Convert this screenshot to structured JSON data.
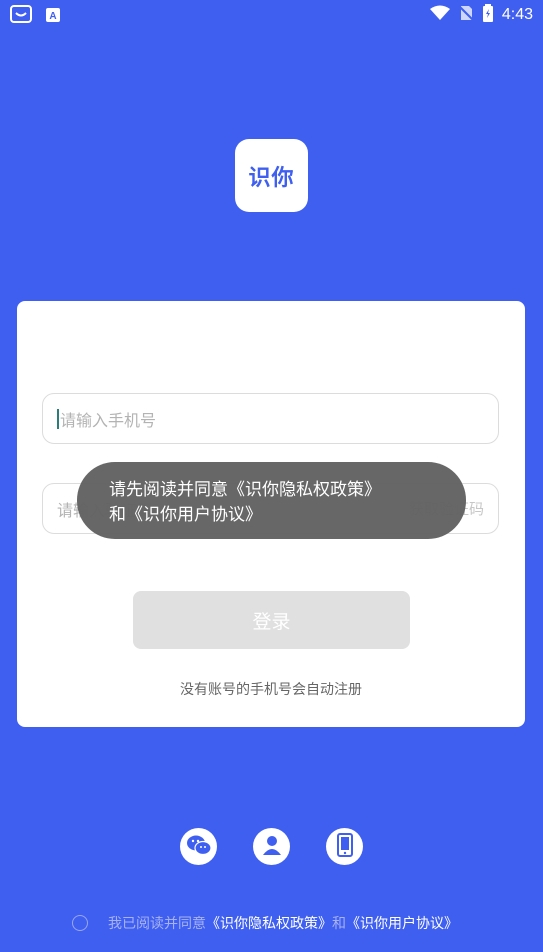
{
  "status_bar": {
    "time": "4:43",
    "left_icons": [
      "face-frame-icon",
      "a-app-icon"
    ],
    "right_icons": [
      "wifi-icon",
      "no-sim-icon",
      "battery-icon"
    ]
  },
  "logo": {
    "text": "识你"
  },
  "form": {
    "phone_placeholder": "请输入手机号",
    "code_placeholder": "请输入验证码",
    "get_code_label": "获取验证码",
    "login_label": "登录",
    "hint": "没有账号的手机号会自动注册"
  },
  "toast": {
    "line1": "请先阅读并同意《识你隐私权政策》",
    "line2": "和《识你用户协议》"
  },
  "social_logins": [
    "wechat-icon",
    "user-icon",
    "phone-icon"
  ],
  "agreement": {
    "prefix": "我已阅读并同意",
    "privacy": "《识你隐私权政策》",
    "and": "和",
    "terms": "《识你用户协议》"
  },
  "colors": {
    "brand": "#3f5ff0",
    "toast": "#626262"
  }
}
